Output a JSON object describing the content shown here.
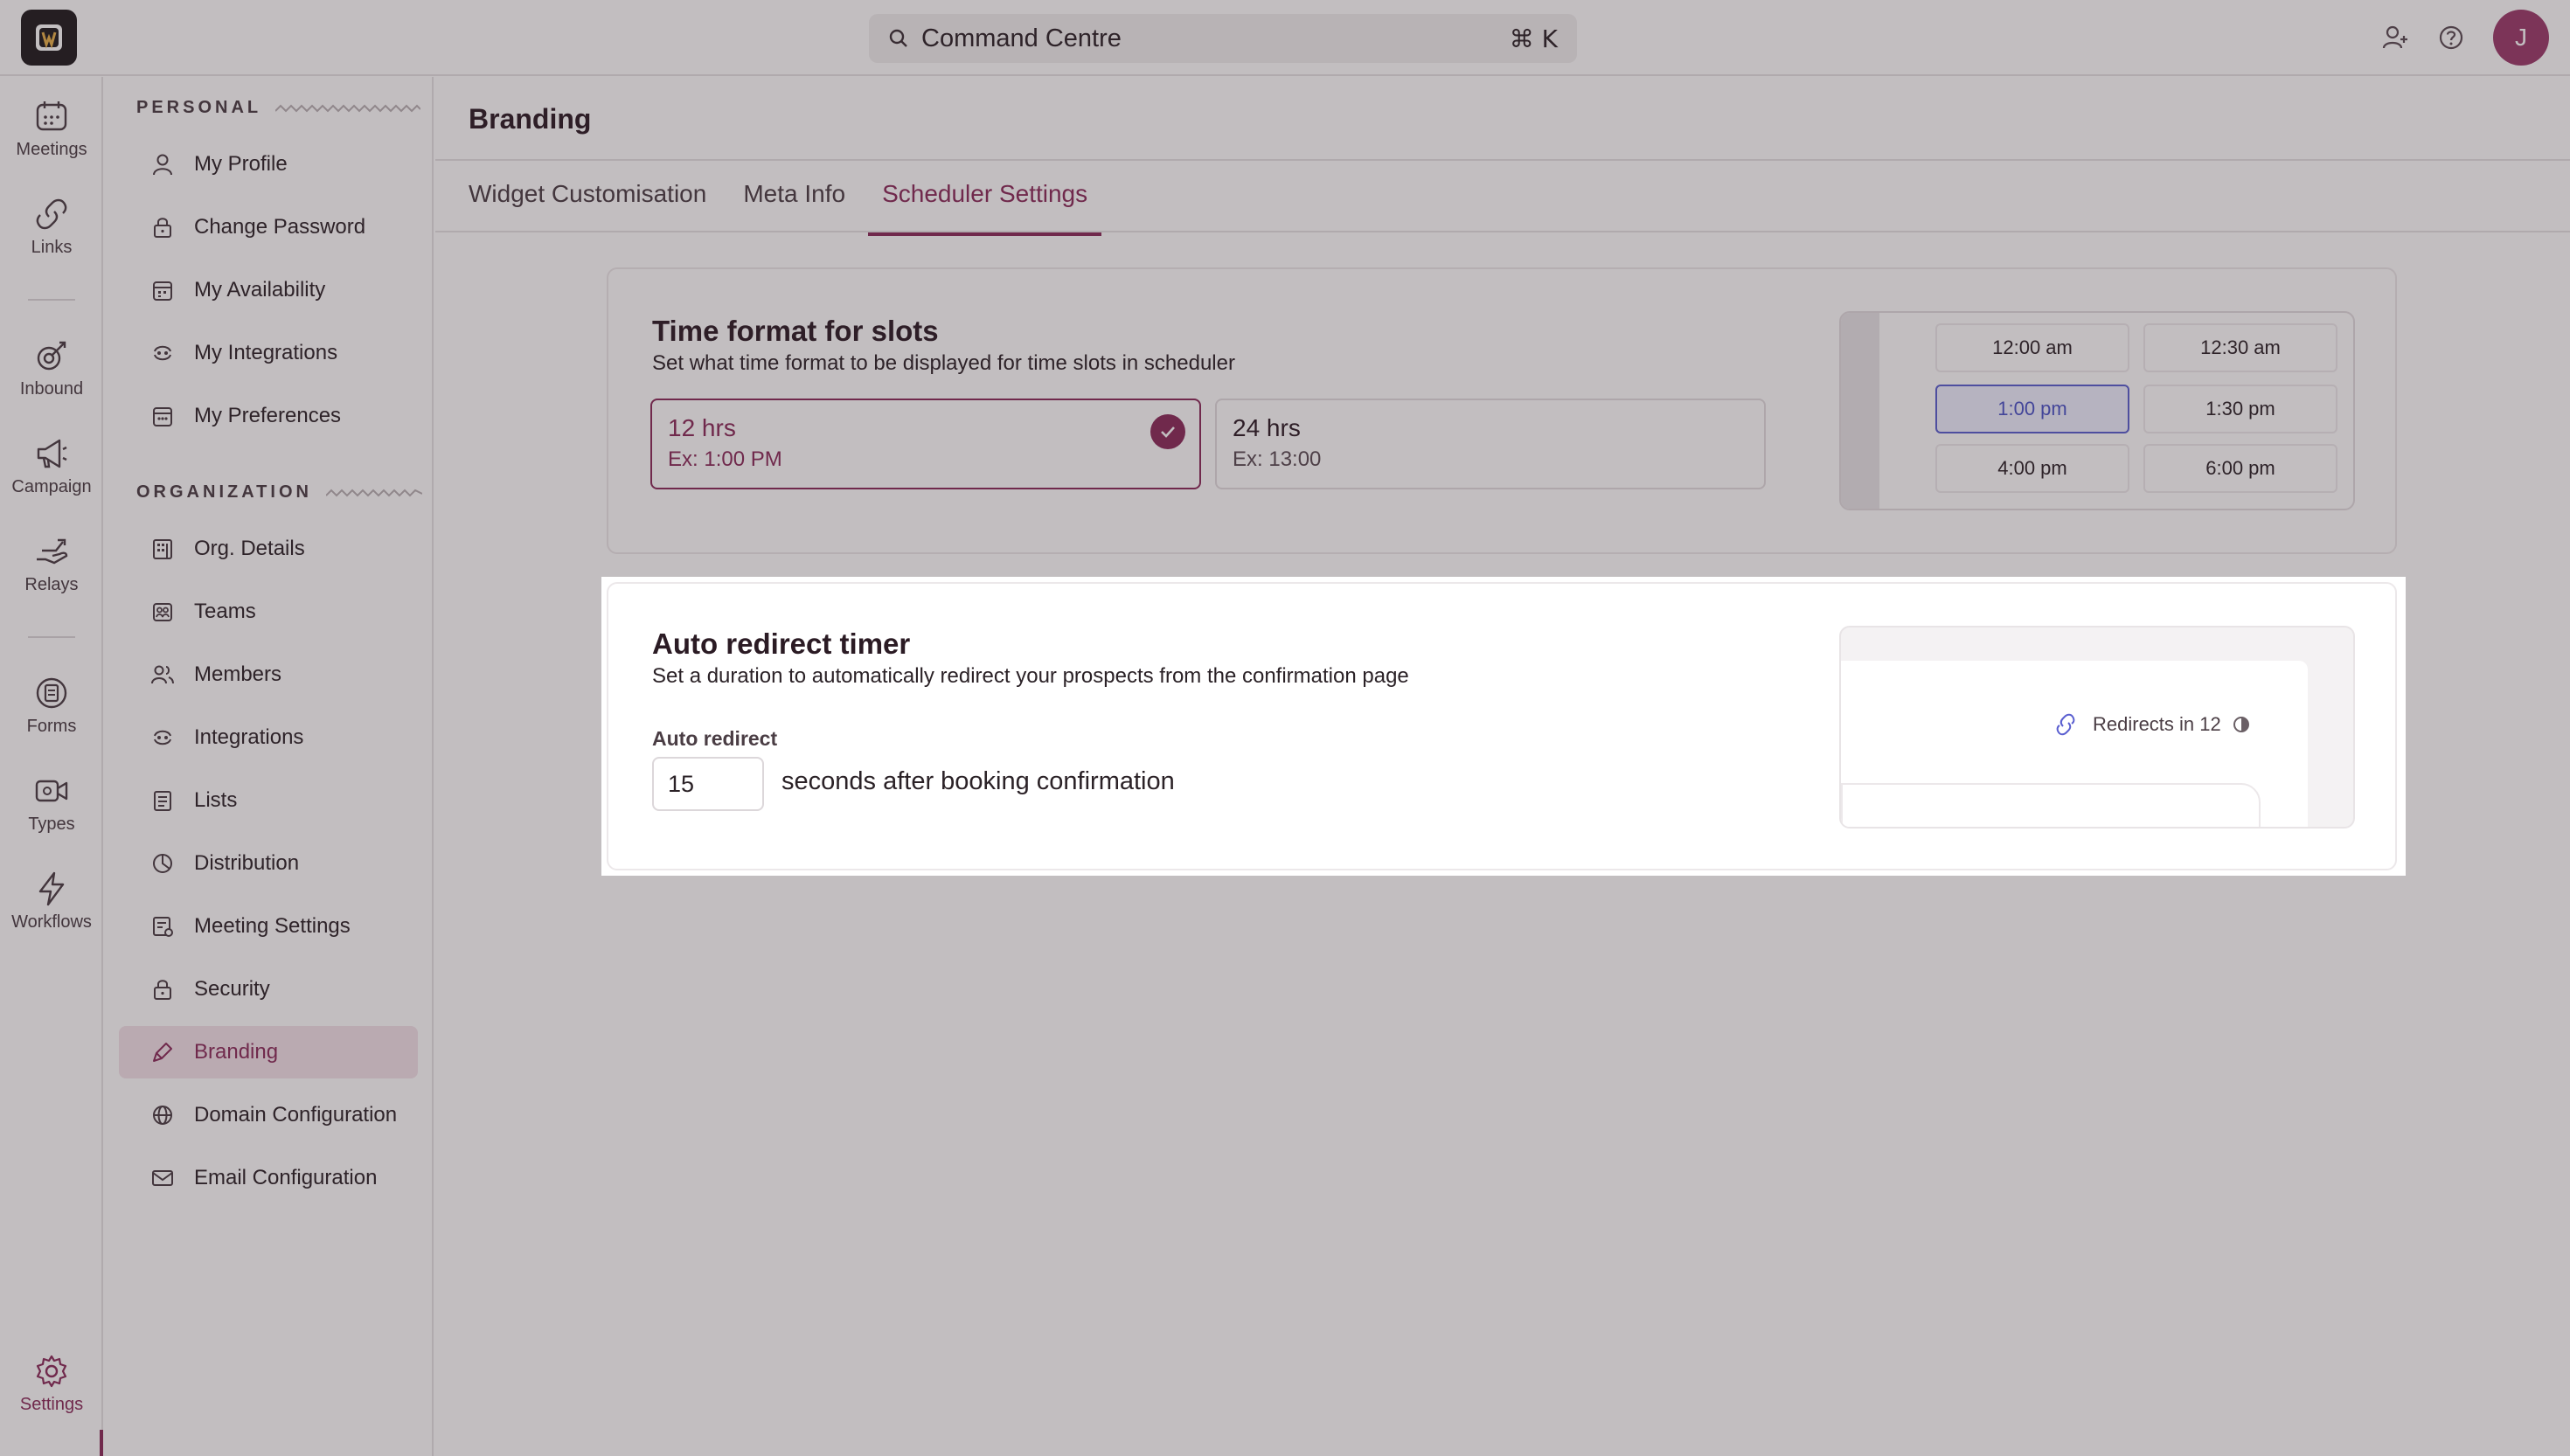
{
  "topbar": {
    "command_label": "Command Centre",
    "command_shortcut": "⌘ K",
    "avatar_initial": "J"
  },
  "rail": [
    {
      "label": "Meetings",
      "icon": "calendar-icon"
    },
    {
      "label": "Links",
      "icon": "link-icon"
    },
    {
      "label": "Inbound",
      "icon": "inbound-icon"
    },
    {
      "label": "Campaign",
      "icon": "megaphone-icon"
    },
    {
      "label": "Relays",
      "icon": "relay-hand-icon"
    },
    {
      "label": "Forms",
      "icon": "form-icon"
    },
    {
      "label": "Types",
      "icon": "video-type-icon"
    },
    {
      "label": "Workflows",
      "icon": "lightning-icon"
    },
    {
      "label": "Settings",
      "icon": "gear-icon"
    }
  ],
  "settings_nav": {
    "personal_heading": "PERSONAL",
    "organization_heading": "ORGANIZATION",
    "personal": [
      {
        "label": "My Profile",
        "icon": "user-icon"
      },
      {
        "label": "Change Password",
        "icon": "lock-icon"
      },
      {
        "label": "My Availability",
        "icon": "calendar-grid-icon"
      },
      {
        "label": "My Integrations",
        "icon": "integration-icon"
      },
      {
        "label": "My Preferences",
        "icon": "preferences-icon"
      }
    ],
    "organization": [
      {
        "label": "Org. Details",
        "icon": "building-icon"
      },
      {
        "label": "Teams",
        "icon": "teams-icon"
      },
      {
        "label": "Members",
        "icon": "members-icon"
      },
      {
        "label": "Integrations",
        "icon": "integration-icon"
      },
      {
        "label": "Lists",
        "icon": "list-icon"
      },
      {
        "label": "Distribution",
        "icon": "pie-icon"
      },
      {
        "label": "Meeting Settings",
        "icon": "meeting-settings-icon"
      },
      {
        "label": "Security",
        "icon": "lock-icon"
      },
      {
        "label": "Branding",
        "icon": "brush-icon",
        "active": true
      },
      {
        "label": "Domain Configuration",
        "icon": "globe-icon"
      },
      {
        "label": "Email Configuration",
        "icon": "mail-icon"
      }
    ]
  },
  "main": {
    "page_title": "Branding",
    "tabs": [
      {
        "label": "Widget Customisation"
      },
      {
        "label": "Meta Info"
      },
      {
        "label": "Scheduler Settings",
        "active": true
      }
    ]
  },
  "time_format": {
    "title": "Time format for slots",
    "subtitle": "Set what time format to be displayed for time slots in scheduler",
    "options": [
      {
        "title": "12 hrs",
        "example": "Ex: 1:00 PM",
        "selected": true
      },
      {
        "title": "24 hrs",
        "example": "Ex: 13:00",
        "selected": false
      }
    ],
    "preview_slots": [
      "12:00 am",
      "12:30 am",
      "1:00 pm",
      "1:30 pm",
      "4:00 pm",
      "6:00 pm"
    ]
  },
  "auto_redirect": {
    "title": "Auto redirect timer",
    "subtitle": "Set a duration to automatically redirect your prospects from the confirmation page",
    "field_label": "Auto redirect",
    "value": "15",
    "suffix": "seconds after booking confirmation",
    "preview_text": "Redirects in 12"
  },
  "colors": {
    "accent": "#8a2a5a",
    "slot_selected": "#4a52c8"
  }
}
